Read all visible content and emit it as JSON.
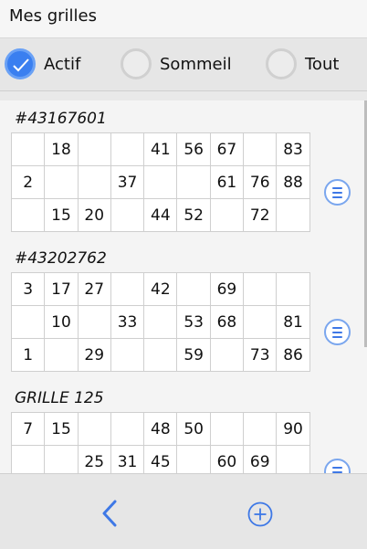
{
  "header": {
    "title": "Mes grilles"
  },
  "filters": [
    {
      "label": "Actif",
      "checked": true
    },
    {
      "label": "Sommeil",
      "checked": false
    },
    {
      "label": "Tout",
      "checked": false
    }
  ],
  "grids": [
    {
      "name": "#43167601",
      "rows": [
        [
          "",
          "18",
          "",
          "",
          "41",
          "56",
          "67",
          "",
          "83"
        ],
        [
          "2",
          "",
          "",
          "37",
          "",
          "",
          "61",
          "76",
          "88"
        ],
        [
          "",
          "15",
          "20",
          "",
          "44",
          "52",
          "",
          "72",
          ""
        ]
      ]
    },
    {
      "name": "#43202762",
      "rows": [
        [
          "3",
          "17",
          "27",
          "",
          "42",
          "",
          "69",
          "",
          ""
        ],
        [
          "",
          "10",
          "",
          "33",
          "",
          "53",
          "68",
          "",
          "81"
        ],
        [
          "1",
          "",
          "29",
          "",
          "",
          "59",
          "",
          "73",
          "86"
        ]
      ]
    },
    {
      "name": "GRILLE 125",
      "rows": [
        [
          "7",
          "15",
          "",
          "",
          "48",
          "50",
          "",
          "",
          "90"
        ],
        [
          "",
          "",
          "25",
          "31",
          "45",
          "",
          "60",
          "69",
          ""
        ],
        [
          "",
          "",
          "",
          "",
          "",
          "",
          "",
          "",
          ""
        ]
      ]
    }
  ],
  "icons": {
    "check": "checkmark-icon",
    "menu": "menu-lines-icon",
    "back": "chevron-left-icon",
    "add": "plus-circle-icon"
  },
  "colors": {
    "accent": "#3a7ff0",
    "icon_blue": "#3e78e6"
  }
}
